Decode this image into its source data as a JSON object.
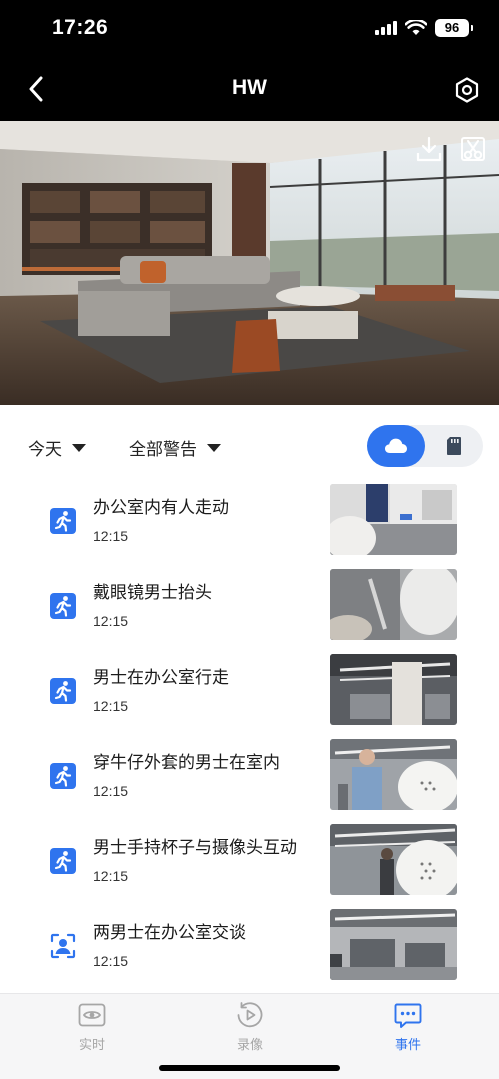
{
  "status": {
    "time": "17:26",
    "battery": "96"
  },
  "nav": {
    "title": "HW"
  },
  "filters": {
    "date": "今天",
    "alert_type": "全部警告"
  },
  "colors": {
    "accent": "#2f74ee",
    "tab_inactive": "#a6a6a6",
    "header_bg": "#000000"
  },
  "events": [
    {
      "title": "办公室内有人走动",
      "time": "12:15",
      "icon": "person-running-icon"
    },
    {
      "title": "戴眼镜男士抬头",
      "time": "12:15",
      "icon": "person-running-icon"
    },
    {
      "title": "男士在办公室行走",
      "time": "12:15",
      "icon": "person-running-icon"
    },
    {
      "title": "穿牛仔外套的男士在室内",
      "time": "12:15",
      "icon": "person-running-icon"
    },
    {
      "title": "男士手持杯子与摄像头互动",
      "time": "12:15",
      "icon": "person-running-icon"
    },
    {
      "title": "两男士在办公室交谈",
      "time": "12:15",
      "icon": "person-detect-icon"
    }
  ],
  "tabs": [
    {
      "label": "实时",
      "icon": "eye-icon",
      "active": false
    },
    {
      "label": "录像",
      "icon": "playback-icon",
      "active": false
    },
    {
      "label": "事件",
      "icon": "message-icon",
      "active": true
    }
  ]
}
